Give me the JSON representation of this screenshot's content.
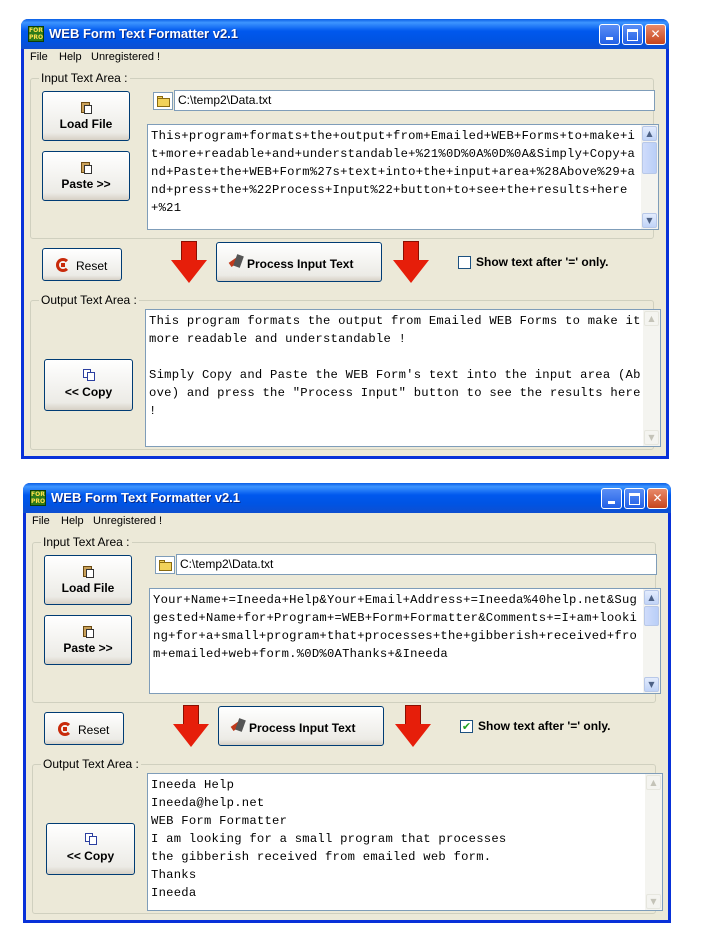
{
  "windows": [
    {
      "title": "WEB Form Text Formatter v2.1",
      "icon_text": "FORM PRO",
      "menu": [
        "File",
        "Help",
        "Unregistered !"
      ],
      "input_group_title": "Input Text Area :",
      "load_file_label": "Load File",
      "paste_label": "Paste >>",
      "file_path": "C:\\temp2\\Data.txt",
      "input_text": "This+program+formats+the+output+from+Emailed+WEB+Forms+to+make+it+more+readable+and+understandable+%21%0D%0A%0D%0A&Simply+Copy+and+Paste+the+WEB+Form%27s+text+into+the+input+area+%28Above%29+and+press+the+%22Process+Input%22+button+to+see+the+results+here+%21",
      "reset_label": "Reset",
      "process_label": "Process Input Text",
      "checkbox_label": "Show text after '=' only.",
      "checkbox_checked": false,
      "output_group_title": "Output Text Area :",
      "copy_label": "<< Copy",
      "output_text": "This program formats the output from Emailed WEB Forms to make it more readable and understandable !\n\nSimply Copy and Paste the WEB Form's text into the input area (Above) and press the \"Process Input\" button to see the results here !"
    },
    {
      "title": "WEB Form Text Formatter v2.1",
      "icon_text": "FORM PRO",
      "menu": [
        "File",
        "Help",
        "Unregistered !"
      ],
      "input_group_title": "Input Text Area :",
      "load_file_label": "Load File",
      "paste_label": "Paste >>",
      "file_path": "C:\\temp2\\Data.txt",
      "input_text": "Your+Name+=Ineeda+Help&Your+Email+Address+=Ineeda%40help.net&Suggested+Name+for+Program+=WEB+Form+Formatter&Comments+=I+am+looking+for+a+small+program+that+processes+the+gibberish+received+from+emailed+web+form.%0D%0AThanks+&Ineeda",
      "reset_label": "Reset",
      "process_label": "Process Input Text",
      "checkbox_label": "Show text after '=' only.",
      "checkbox_checked": true,
      "checkbox_mark": "✔",
      "output_group_title": "Output Text Area :",
      "copy_label": "<< Copy",
      "output_text": "Ineeda Help\nIneeda@help.net\nWEB Form Formatter\nI am looking for a small program that processes\nthe gibberish received from emailed web form.\nThanks\nIneeda"
    }
  ]
}
